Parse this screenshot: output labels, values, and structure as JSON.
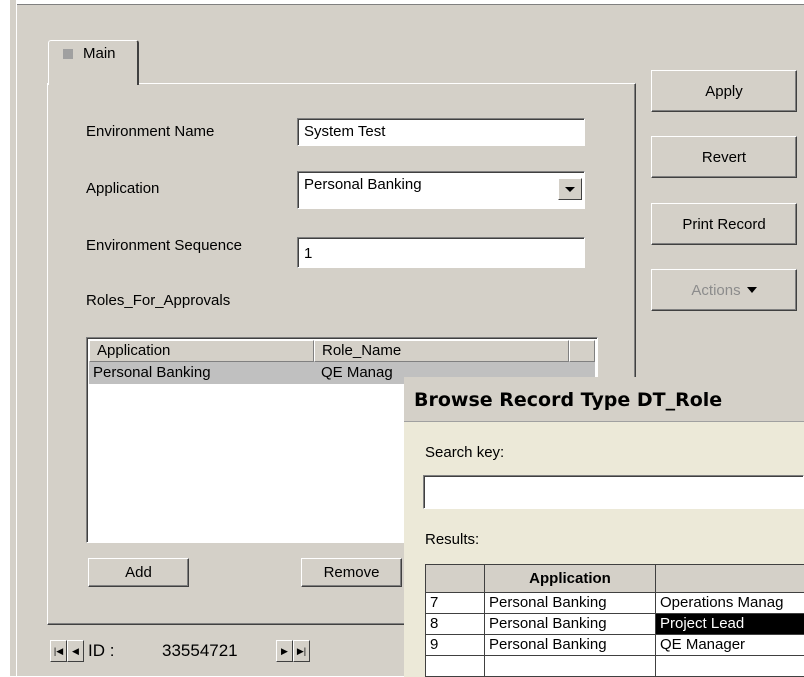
{
  "tab": {
    "label": "Main"
  },
  "form": {
    "environment_name_label": "Environment Name",
    "environment_name_value": "System Test",
    "application_label": "Application",
    "application_value": "Personal Banking",
    "environment_sequence_label": "Environment Sequence",
    "environment_sequence_value": "1",
    "roles_label": "Roles_For_Approvals"
  },
  "roles_table": {
    "columns": [
      "Application",
      "Role_Name"
    ],
    "rows": [
      {
        "application": "Personal Banking",
        "role_name": "QE Manag"
      }
    ],
    "add_label": "Add",
    "remove_label": "Remove"
  },
  "side_buttons": {
    "apply": "Apply",
    "revert": "Revert",
    "print_record": "Print Record",
    "actions": "Actions"
  },
  "nav": {
    "id_label": "ID :",
    "id_value": "33554721"
  },
  "dialog": {
    "title": "Browse Record Type DT_Role",
    "search_label": "Search key:",
    "search_value": "",
    "results_label": "Results:",
    "columns": [
      "",
      "Application",
      ""
    ],
    "rows": [
      {
        "num": "7",
        "application": "Personal Banking",
        "role": "Operations Manag"
      },
      {
        "num": "8",
        "application": "Personal Banking",
        "role": "Project Lead"
      },
      {
        "num": "9",
        "application": "Personal Banking",
        "role": "QE Manager"
      }
    ],
    "selected_row": 1
  },
  "colors": {
    "face": "#d4d0c8",
    "selection": "#000000",
    "list_selection": "#c0c0c0"
  }
}
